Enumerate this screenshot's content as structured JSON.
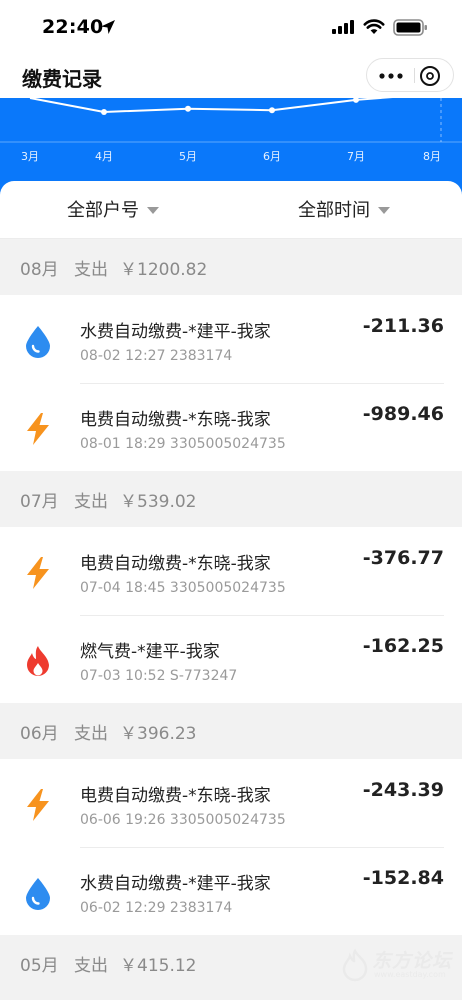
{
  "status_bar": {
    "time": "22:40"
  },
  "nav": {
    "title": "缴费记录"
  },
  "chart_data": {
    "type": "line",
    "x": [
      "3月",
      "4月",
      "5月",
      "6月",
      "7月",
      "8月"
    ],
    "note_visible_partial": true,
    "values_relative": [
      null,
      0.0,
      0.15,
      0.08,
      0.55,
      null
    ]
  },
  "filters": {
    "account": "全部户号",
    "time": "全部时间"
  },
  "months": [
    {
      "month": "08月",
      "spend_label": "支出",
      "total": "￥1200.82",
      "records": [
        {
          "type": "water",
          "title": "水费自动缴费-*建平-我家",
          "sub": "08-02 12:27 2383174",
          "amount": "-211.36"
        },
        {
          "type": "electric",
          "title": "电费自动缴费-*东晓-我家",
          "sub": "08-01 18:29 3305005024735",
          "amount": "-989.46"
        }
      ]
    },
    {
      "month": "07月",
      "spend_label": "支出",
      "total": "￥539.02",
      "records": [
        {
          "type": "electric",
          "title": "电费自动缴费-*东晓-我家",
          "sub": "07-04 18:45 3305005024735",
          "amount": "-376.77"
        },
        {
          "type": "gas",
          "title": "燃气费-*建平-我家",
          "sub": "07-03 10:52 S-773247",
          "amount": "-162.25"
        }
      ]
    },
    {
      "month": "06月",
      "spend_label": "支出",
      "total": "￥396.23",
      "records": [
        {
          "type": "electric",
          "title": "电费自动缴费-*东晓-我家",
          "sub": "06-06 19:26 3305005024735",
          "amount": "-243.39"
        },
        {
          "type": "water",
          "title": "水费自动缴费-*建平-我家",
          "sub": "06-02 12:29 2383174",
          "amount": "-152.84"
        }
      ]
    },
    {
      "month": "05月",
      "spend_label": "支出",
      "total": "￥415.12",
      "records": []
    }
  ],
  "watermark": {
    "text": "东方论坛",
    "sub": "www.eastday.com"
  },
  "colors": {
    "chart_bg": "#0a78fa",
    "water": "#2d8cf0",
    "electric": "#f7931e",
    "gas": "#ee3b2f"
  }
}
